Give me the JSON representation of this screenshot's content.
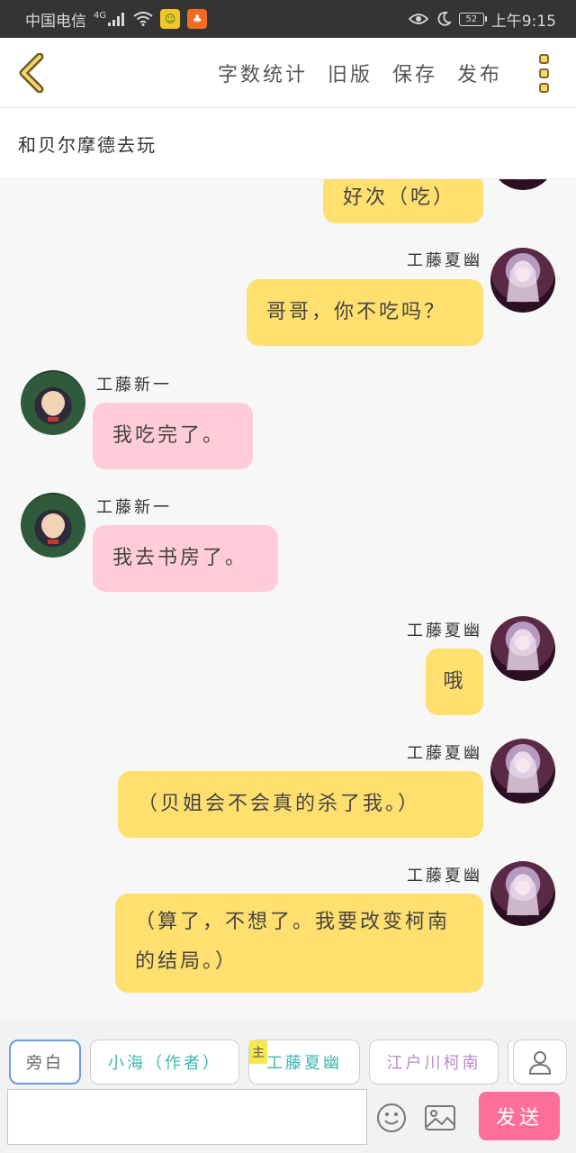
{
  "status_bar": {
    "carrier": "中国电信",
    "network": "4G",
    "battery": "52",
    "time": "上午9:15"
  },
  "toolbar": {
    "actions": [
      "字数统计",
      "旧版",
      "保存",
      "发布"
    ]
  },
  "story": {
    "title": "和贝尔摩德去玩"
  },
  "messages": [
    {
      "side": "right",
      "sender": "",
      "text": "好次（吃）"
    },
    {
      "side": "right",
      "sender": "工藤夏幽",
      "text": "哥哥，你不吃吗？"
    },
    {
      "side": "left",
      "sender": "工藤新一",
      "text": "我吃完了。"
    },
    {
      "side": "left",
      "sender": "工藤新一",
      "text": "我去书房了。"
    },
    {
      "side": "right",
      "sender": "工藤夏幽",
      "text": "哦"
    },
    {
      "side": "right",
      "sender": "工藤夏幽",
      "text": "（贝姐会不会真的杀了我。）"
    },
    {
      "side": "right",
      "sender": "工藤夏幽",
      "text": "（算了，不想了。我要改变柯南的结局。）"
    }
  ],
  "roles": {
    "tabs": [
      {
        "label": "旁白",
        "color": "#666666"
      },
      {
        "label": "小海（作者）",
        "color": "#3bb8b0"
      },
      {
        "label": "工藤夏幽",
        "color": "#3bb8b0",
        "badge": "主"
      },
      {
        "label": "江户川柯南",
        "color": "#b88ad0"
      }
    ]
  },
  "composer": {
    "placeholder": "",
    "send_label": "发送"
  },
  "colors": {
    "status_bar": "#343434",
    "right_bubble": "#ffdf6e",
    "left_bubble": "#ffccd8",
    "send_button": "#ff6e9a",
    "active_tab_border": "#6a9ce0"
  }
}
